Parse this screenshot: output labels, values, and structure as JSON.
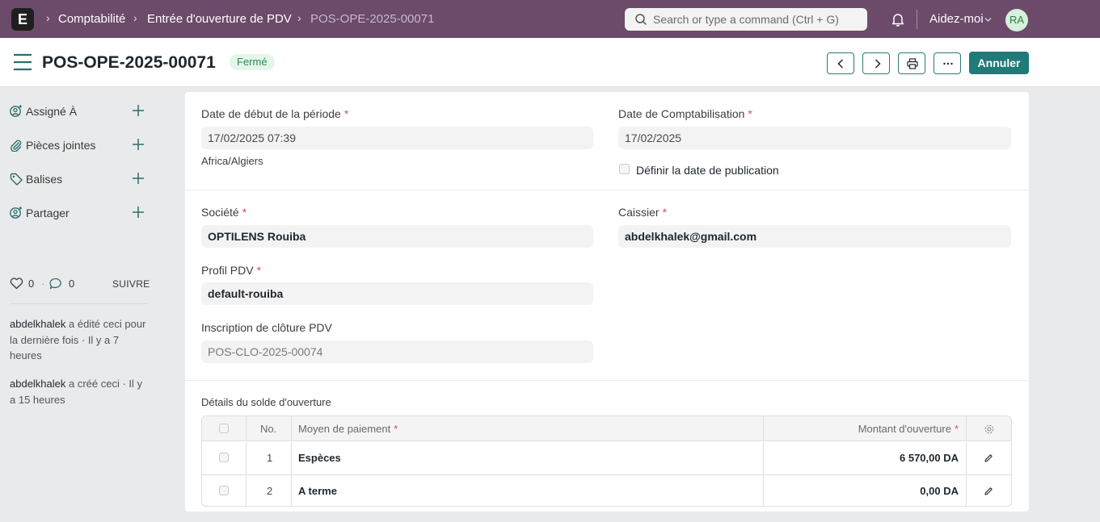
{
  "navbar": {
    "logo": "E",
    "breadcrumbs": [
      "Comptabilité",
      "Entrée d'ouverture de PDV",
      "POS-OPE-2025-00071"
    ],
    "search_placeholder": "Search or type a command (Ctrl + G)",
    "help_label": "Aidez-moi",
    "avatar_initials": "RA"
  },
  "header": {
    "title": "POS-OPE-2025-00071",
    "status": "Fermé",
    "primary_action": "Annuler"
  },
  "sidebar": {
    "items": [
      {
        "label": "Assigné À",
        "icon": "user-assign-icon"
      },
      {
        "label": "Pièces jointes",
        "icon": "paperclip-icon"
      },
      {
        "label": "Balises",
        "icon": "tag-icon"
      },
      {
        "label": "Partager",
        "icon": "share-icon"
      }
    ],
    "likes": "0",
    "comments": "0",
    "follow_label": "SUIVRE",
    "activity": [
      {
        "user": "abdelkhalek",
        "text": " a édité ceci pour la dernière fois · Il y a 7 heures"
      },
      {
        "user": "abdelkhalek",
        "text": " a créé ceci · Il y a 15 heures"
      }
    ]
  },
  "form": {
    "period_start_label": "Date de début de la période",
    "period_start_value": "17/02/2025 07:39",
    "timezone": "Africa/Algiers",
    "posting_date_label": "Date de Comptabilisation",
    "posting_date_value": "17/02/2025",
    "set_posting_date_label": "Définir la date de publication",
    "company_label": "Société",
    "company_value": "OPTILENS Rouiba",
    "cashier_label": "Caissier",
    "cashier_value": "abdelkhalek@gmail.com",
    "pos_profile_label": "Profil PDV",
    "pos_profile_value": "default-rouiba",
    "closing_entry_label": "Inscription de clôture PDV",
    "closing_entry_value": "POS-CLO-2025-00074"
  },
  "table": {
    "title": "Détails du solde d'ouverture",
    "columns": {
      "no": "No.",
      "mode": "Moyen de paiement",
      "amount": "Montant d'ouverture"
    },
    "rows": [
      {
        "no": "1",
        "mode": "Espèces",
        "amount": "6 570,00 DA"
      },
      {
        "no": "2",
        "mode": "A terme",
        "amount": "0,00 DA"
      }
    ]
  }
}
